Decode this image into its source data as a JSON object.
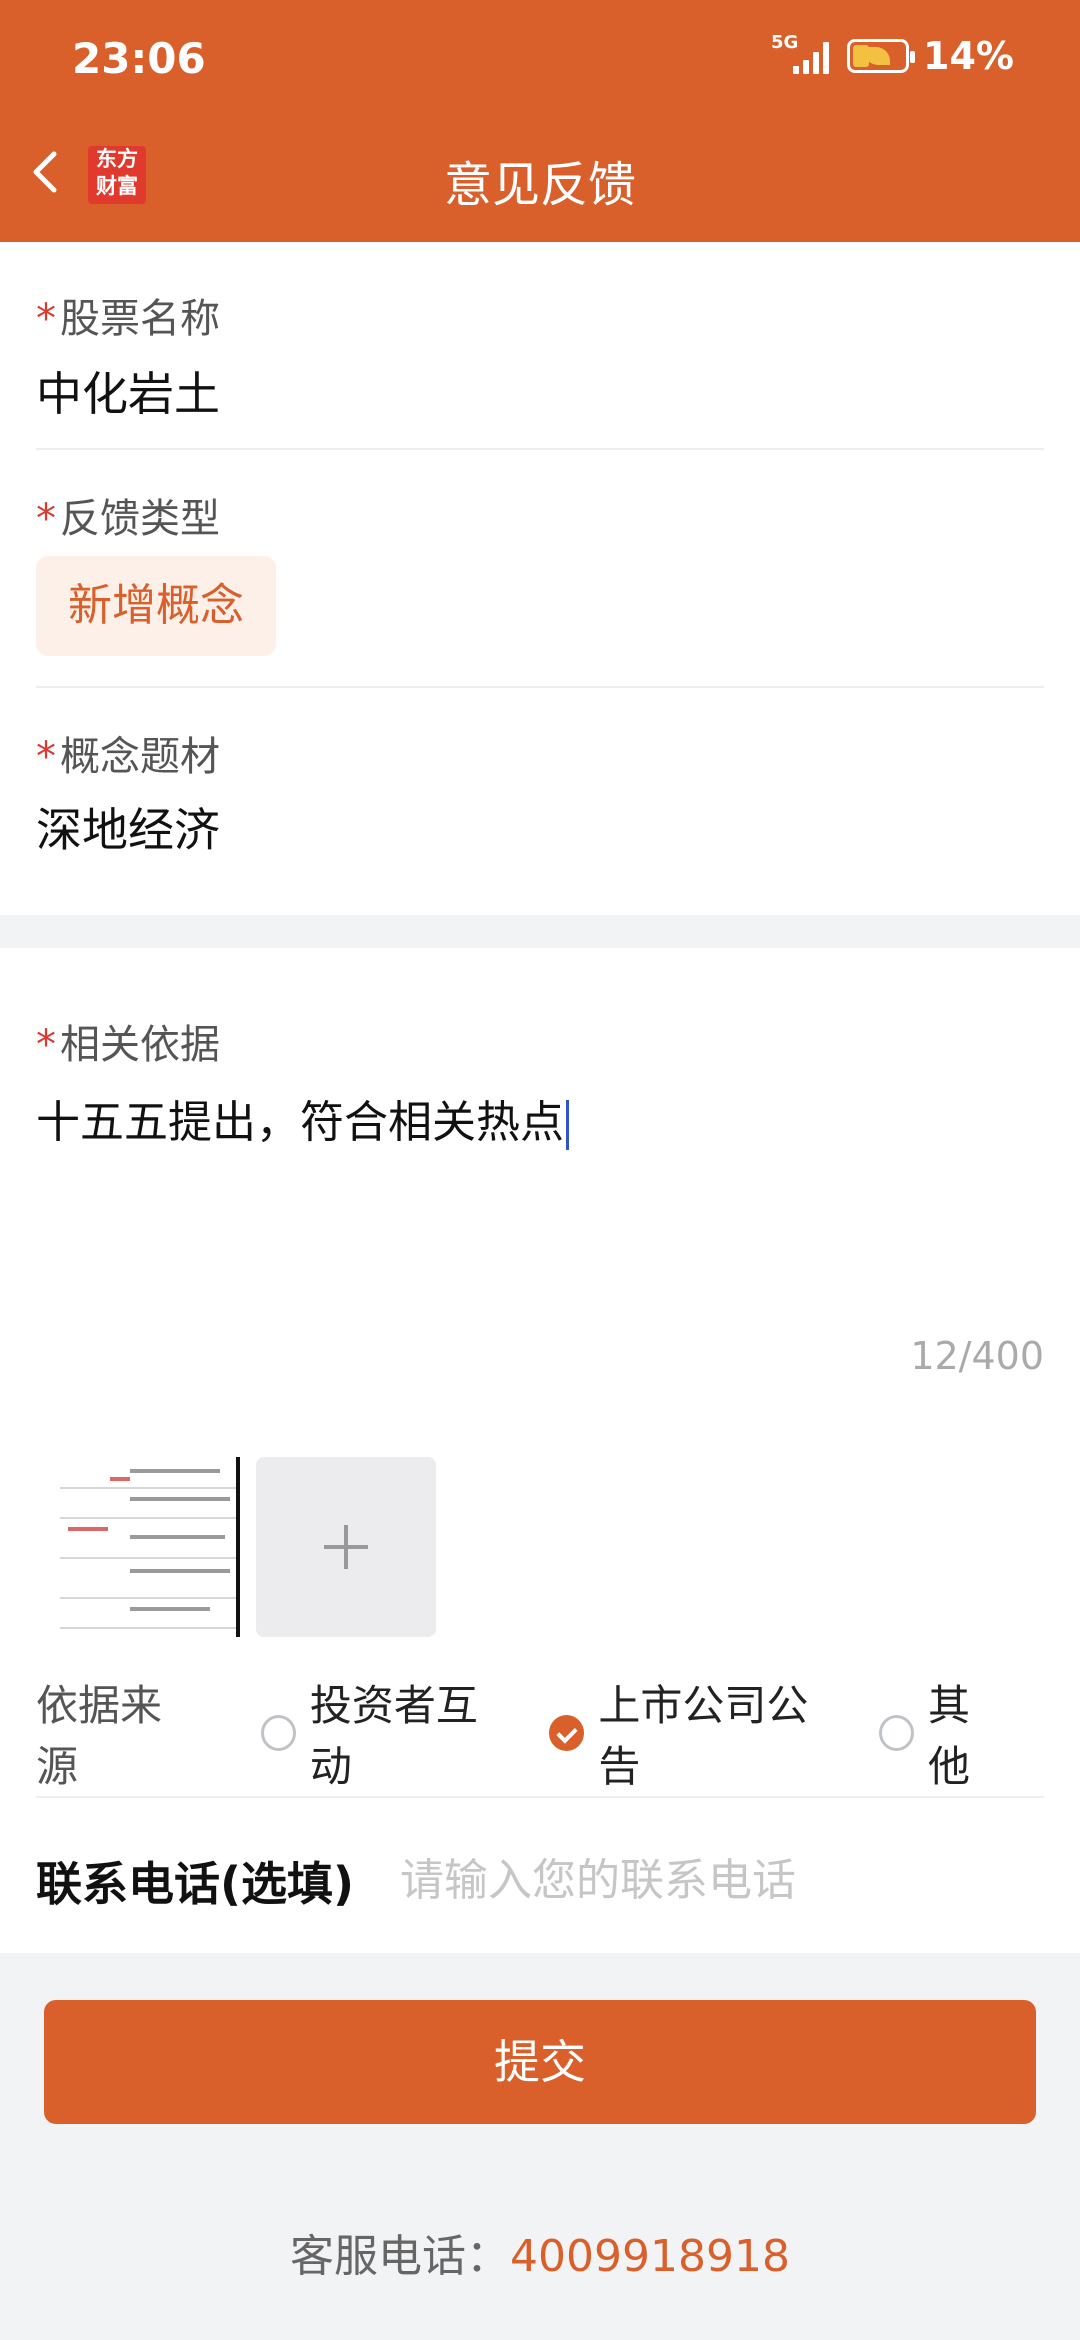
{
  "status_bar": {
    "time": "23:06",
    "network": "5G",
    "battery": "14%"
  },
  "header": {
    "title": "意见反馈",
    "logo_text": "东方财富"
  },
  "form": {
    "stock_name": {
      "label": "股票名称",
      "value": "中化岩土"
    },
    "feedback_type": {
      "label": "反馈类型",
      "value": "新增概念"
    },
    "concept": {
      "label": "概念题材",
      "value": "深地经济"
    },
    "basis": {
      "label": "相关依据",
      "value": "十五五提出，符合相关热点",
      "counter": "12/400"
    },
    "source": {
      "label": "依据来源",
      "options": [
        {
          "label": "投资者互动",
          "selected": false
        },
        {
          "label": "上市公司公告",
          "selected": true
        },
        {
          "label": "其他",
          "selected": false
        }
      ]
    },
    "phone": {
      "label": "联系电话(选填)",
      "placeholder": "请输入您的联系电话"
    }
  },
  "submit_label": "提交",
  "service": {
    "label": "客服电话：",
    "number": "4009918918"
  },
  "colors": {
    "brand": "#d95f2b",
    "required": "#d93a2f"
  }
}
